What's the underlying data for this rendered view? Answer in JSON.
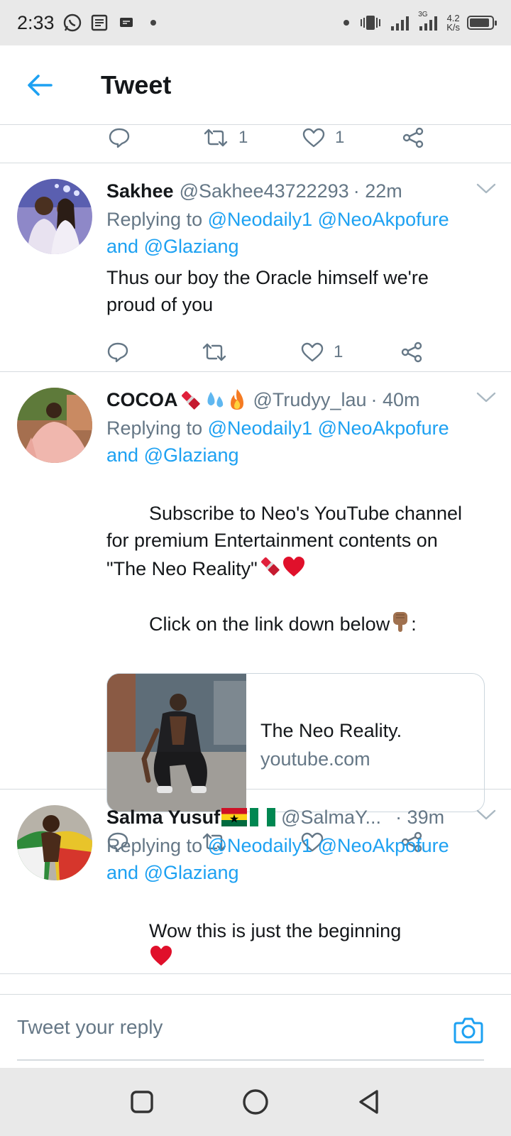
{
  "status_bar": {
    "time": "2:33",
    "net_speed_value": "4.2",
    "net_speed_unit": "K/s",
    "network_label": "3G",
    "battery_level": 0.9
  },
  "header": {
    "title": "Tweet"
  },
  "partial_tweet": {
    "retweet_count": "1",
    "like_count": "1"
  },
  "tweets": [
    {
      "name": "Sakhee",
      "handle": "@Sakhee43722293",
      "time": "· 22m",
      "replying_prefix": "Replying to",
      "mention_1": "@Neodaily1",
      "mention_2": "@NeoAkpofure",
      "replying_and": "and",
      "mention_3": "@Glaziang",
      "text": "Thus our boy the Oracle himself we're proud of you",
      "retweet_count": "",
      "like_count": "1"
    },
    {
      "name": "COCOA",
      "handle": "@Trudyy_lau",
      "time": "· 40m",
      "replying_prefix": "Replying to",
      "mention_1": "@Neodaily1",
      "mention_2": "@NeoAkpofure",
      "replying_and": "and",
      "mention_3": "@Glaziang",
      "text_line_1": "Subscribe to Neo's YouTube channel for premium Entertainment contents on \"The Neo Reality\"",
      "text_line_2": "Click on the link down below",
      "text_line_2_end": ":",
      "card_title": "The Neo Reality.",
      "card_domain": "youtube.com",
      "retweet_count": "",
      "like_count": ""
    },
    {
      "name": "Salma Yusuf",
      "handle": "@SalmaY...",
      "time": "· 39m",
      "replying_prefix": "Replying to",
      "mention_1": "@Neodaily1",
      "mention_2": "@NeoAkpofure",
      "replying_and": "and",
      "mention_3": "@Glaziang",
      "text": "Wow this is just the beginning",
      "retweet_count": "",
      "like_count": ""
    }
  ],
  "reply_bar": {
    "placeholder": "Tweet your reply"
  },
  "colors": {
    "accent": "#1da1f2",
    "muted": "#657786",
    "text": "#14171a",
    "divider": "#d6dbdf"
  }
}
